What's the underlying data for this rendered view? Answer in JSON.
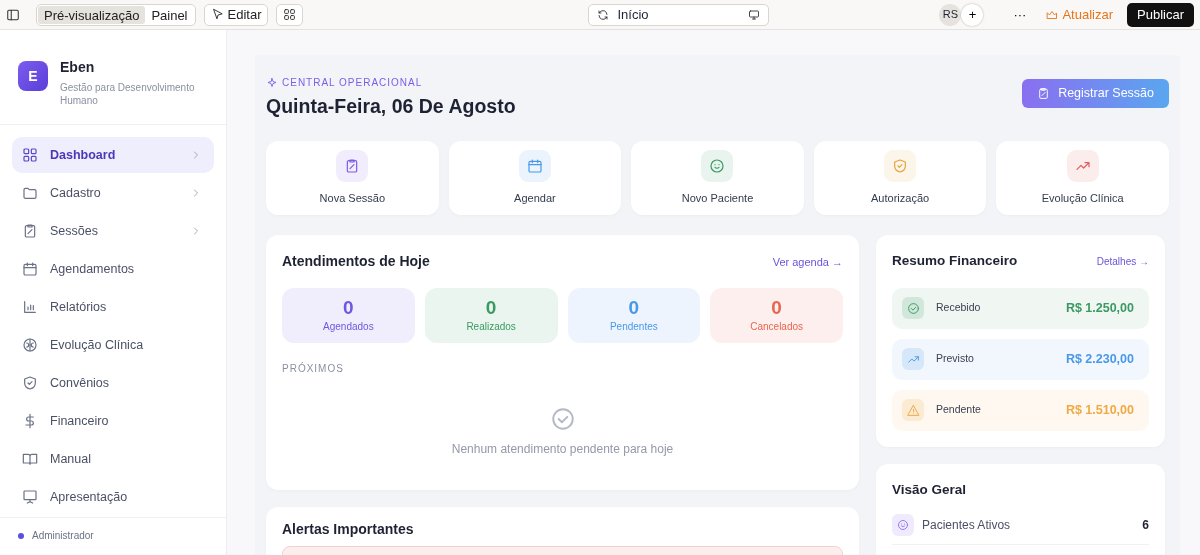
{
  "toolbar": {
    "view_tabs": [
      {
        "label": "Pré-visualização",
        "selected": true
      },
      {
        "label": "Painel",
        "selected": false
      }
    ],
    "edit_button": "Editar",
    "address": "Início",
    "avatar": "RS",
    "add": "+",
    "more": "···",
    "update_button": "Atualizar",
    "publish_button": "Publicar"
  },
  "sidebar": {
    "brand": {
      "initial": "E",
      "name": "Eben",
      "tagline": "Gestão para Desenvolvimento Humano"
    },
    "items": [
      {
        "label": "Dashboard",
        "selected": true,
        "expandable": true
      },
      {
        "label": "Cadastro",
        "selected": false,
        "expandable": true
      },
      {
        "label": "Sessões",
        "selected": false,
        "expandable": true
      },
      {
        "label": "Agendamentos",
        "selected": false,
        "expandable": false
      },
      {
        "label": "Relatórios",
        "selected": false,
        "expandable": false
      },
      {
        "label": "Evolução Clínica",
        "selected": false,
        "expandable": false
      },
      {
        "label": "Convênios",
        "selected": false,
        "expandable": false
      },
      {
        "label": "Financeiro",
        "selected": false,
        "expandable": false
      },
      {
        "label": "Manual",
        "selected": false,
        "expandable": false
      },
      {
        "label": "Apresentação",
        "selected": false,
        "expandable": false
      }
    ],
    "user_role": "Administrador"
  },
  "header": {
    "eyebrow": "CENTRAL OPERACIONAL",
    "title": "Quinta-Feira, 06 De Agosto",
    "action": "Registrar Sessão"
  },
  "quick_actions": [
    {
      "label": "Nova Sessão",
      "color": "#7c5ce8"
    },
    {
      "label": "Agendar",
      "color": "#4a98e8"
    },
    {
      "label": "Novo Paciente",
      "color": "#3a9a62"
    },
    {
      "label": "Autorização",
      "color": "#e8a33a"
    },
    {
      "label": "Evolução Clínica",
      "color": "#e85a5a"
    }
  ],
  "today": {
    "title": "Atendimentos de Hoje",
    "link": "Ver agenda →",
    "stats": [
      {
        "value": "0",
        "label": "Agendados",
        "color": "#6d58e0"
      },
      {
        "value": "0",
        "label": "Realizados",
        "color": "#3a9a62"
      },
      {
        "value": "0",
        "label": "Pendentes",
        "color": "#4a98e8"
      },
      {
        "value": "0",
        "label": "Cancelados",
        "color": "#e8664f"
      }
    ],
    "upcoming_label": "PRÓXIMOS",
    "empty_message": "Nenhum atendimento pendente para hoje"
  },
  "alerts": {
    "title": "Alertas Importantes"
  },
  "finance": {
    "title": "Resumo Financeiro",
    "link": "Detalhes →",
    "rows": [
      {
        "label": "Recebido",
        "amount": "R$ 1.250,00",
        "color": "#3a9a62"
      },
      {
        "label": "Previsto",
        "amount": "R$ 2.230,00",
        "color": "#4a98e8"
      },
      {
        "label": "Pendente",
        "amount": "R$ 1.510,00",
        "color": "#efaa45"
      }
    ]
  },
  "overview": {
    "title": "Visão Geral",
    "rows": [
      {
        "label": "Pacientes Ativos",
        "value": "6"
      }
    ]
  }
}
